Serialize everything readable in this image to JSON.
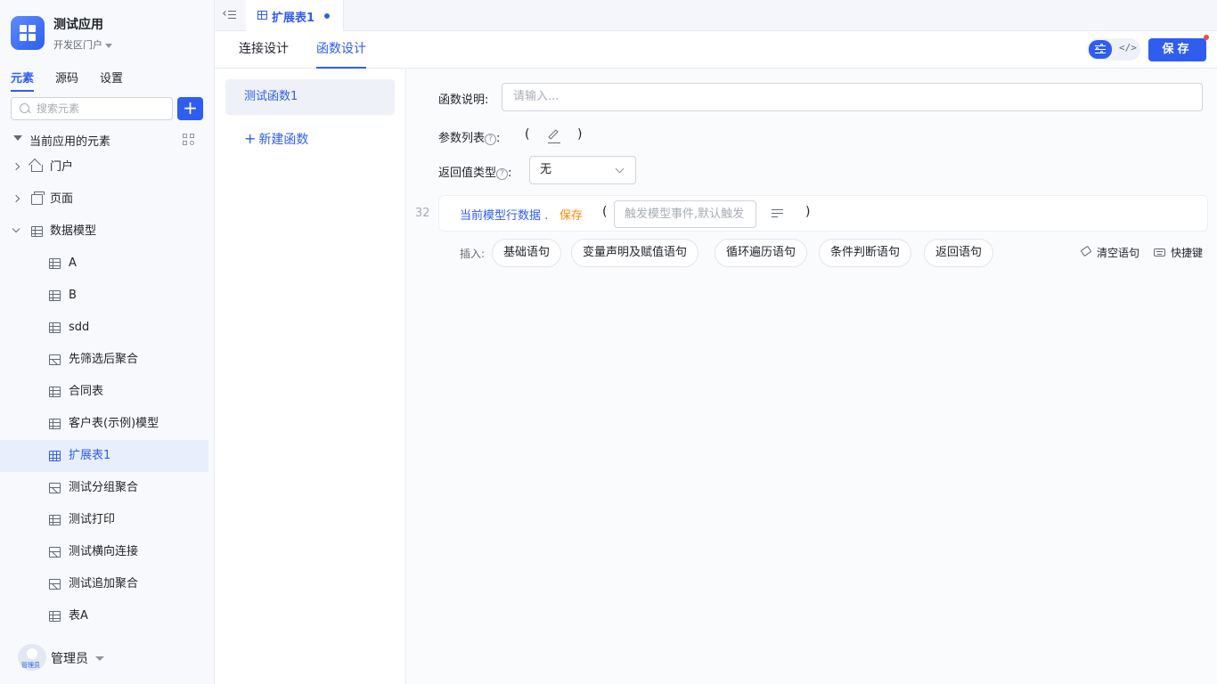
{
  "app": {
    "title": "测试应用",
    "portal": "开发区门户"
  },
  "sidebar": {
    "tabs": [
      "元素",
      "源码",
      "设置"
    ],
    "search_placeholder": "搜索元素",
    "add_label": "+",
    "tree_root": "当前应用的元素",
    "groups": [
      "门户",
      "页面",
      "数据模型"
    ],
    "models": [
      "A",
      "B",
      "sdd",
      "先筛选后聚合",
      "合同表",
      "客户表(示例)模型",
      "扩展表1",
      "测试分组聚合",
      "测试打印",
      "测试横向连接",
      "测试追加聚合",
      "表A"
    ],
    "active_model": "扩展表1"
  },
  "user": {
    "name": "管理员",
    "avatar_tag": "管理员"
  },
  "doc_tab": {
    "label": "扩展表1"
  },
  "subtabs": [
    "连接设计",
    "函数设计"
  ],
  "toolbar": {
    "code_label": "</>",
    "save_label": "保存"
  },
  "functions": {
    "items": [
      "测试函数1"
    ],
    "new_label": "新建函数"
  },
  "editor": {
    "desc_label": "函数说明:",
    "desc_placeholder": "请输入...",
    "params_label": "参数列表",
    "help_glyph": "?",
    "colon": ":",
    "paren_open": "(",
    "paren_close": ")",
    "return_label": "返回值类型",
    "return_value": "无",
    "statement": {
      "line_no": "32",
      "object": "当前模型行数据 .",
      "method": "保存",
      "arg_placeholder": "触发模型事件,默认触发"
    },
    "insert_label": "插入:",
    "insert_buttons": [
      "基础语句",
      "变量声明及赋值语句",
      "循环遍历语句",
      "条件判断语句",
      "返回语句"
    ],
    "clear_label": "清空语句",
    "shortcut_label": "快捷键"
  },
  "colors": {
    "accent": "#2f5df0",
    "method": "#ff8800",
    "dot": "#f54a45"
  }
}
